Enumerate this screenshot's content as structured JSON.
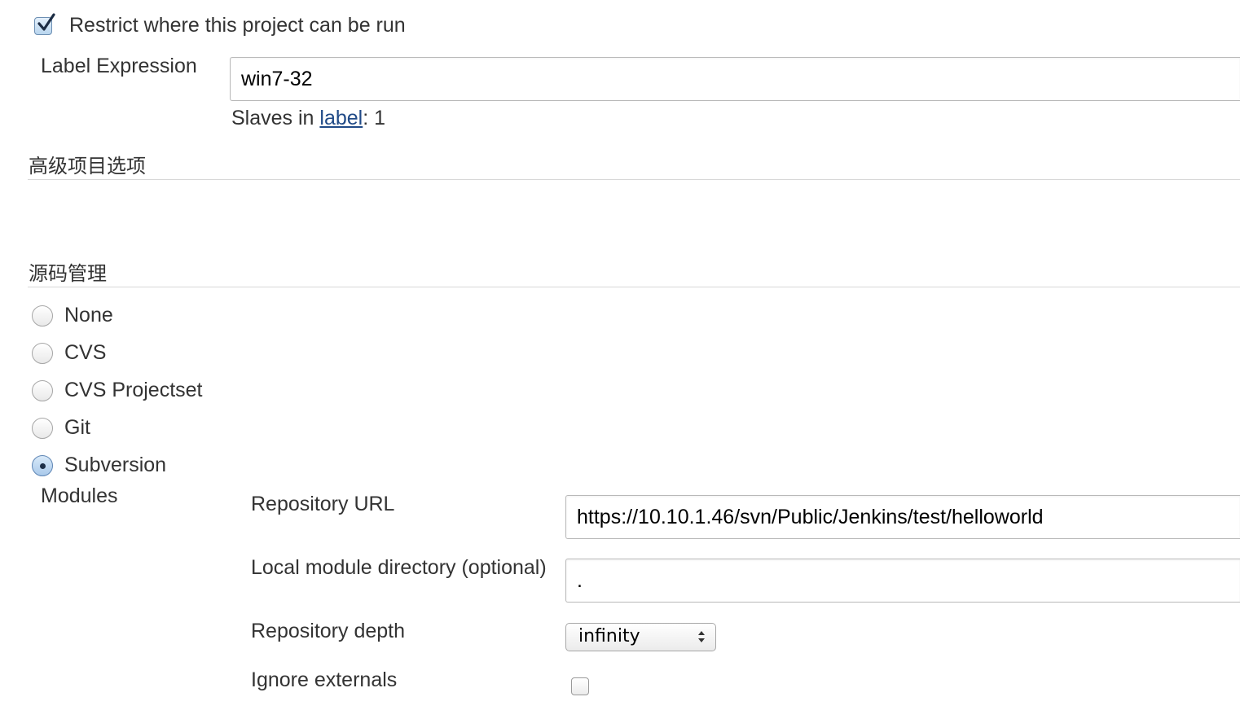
{
  "restrict": {
    "checked": true,
    "label": "Restrict where this project can be run"
  },
  "label_expression": {
    "label": "Label Expression",
    "value": "win7-32",
    "slaves_prefix": "Slaves in ",
    "slaves_link": "label",
    "slaves_suffix": ": 1"
  },
  "advanced_section": {
    "title": "高级项目选项"
  },
  "scm_section": {
    "title": "源码管理",
    "options": [
      {
        "label": "None",
        "selected": false
      },
      {
        "label": "CVS",
        "selected": false
      },
      {
        "label": "CVS Projectset",
        "selected": false
      },
      {
        "label": "Git",
        "selected": false
      },
      {
        "label": "Subversion",
        "selected": true
      }
    ]
  },
  "modules": {
    "label": "Modules",
    "repository_url": {
      "label": "Repository URL",
      "value": "https://10.10.1.46/svn/Public/Jenkins/test/helloworld"
    },
    "local_module_directory": {
      "label": "Local module directory (optional)",
      "value": "."
    },
    "repository_depth": {
      "label": "Repository depth",
      "value": "infinity"
    },
    "ignore_externals": {
      "label": "Ignore externals",
      "checked": false
    }
  },
  "colors": {
    "link": "#204a87",
    "text": "#333333",
    "border": "#b9b9b9",
    "section_line": "#d8d8d8",
    "radio_selected": "#5f86b5"
  }
}
